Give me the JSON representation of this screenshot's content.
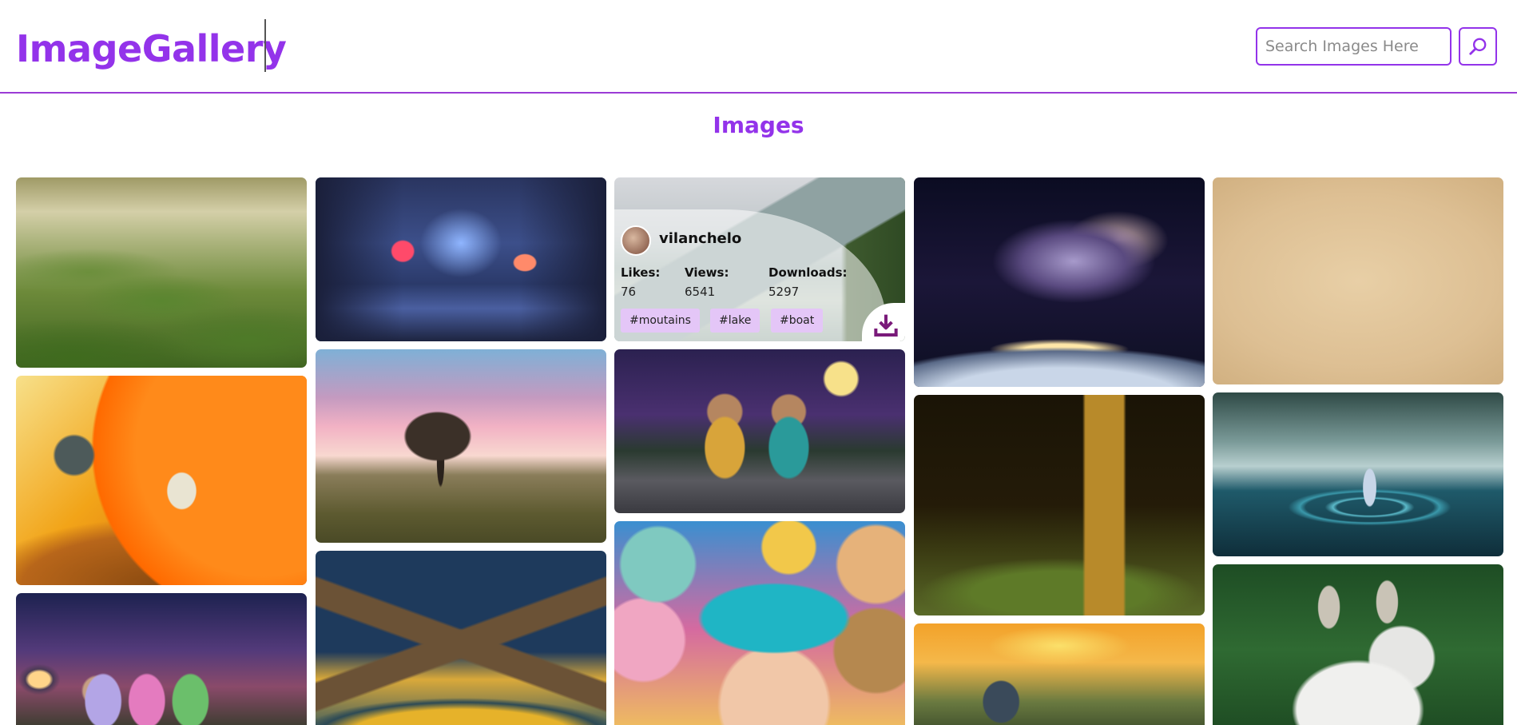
{
  "header": {
    "logo": "ImageGallery",
    "search_placeholder": "Search Images Here",
    "search_icon": "search-icon"
  },
  "section_title": "Images",
  "hover_card": {
    "username": "vilanchelo",
    "likes_label": "Likes:",
    "likes": "76",
    "views_label": "Views:",
    "views": "6541",
    "downloads_label": "Downloads:",
    "downloads": "5297",
    "tags": [
      "#moutains",
      "#lake",
      "#boat"
    ],
    "download_icon": "download-icon"
  },
  "images": [
    "misty-green-hills",
    "neon-city-street-rain",
    "mountain-lake",
    "galaxy-over-planet",
    "parchment-texture",
    "astronaut-orange-planet",
    "lone-tree-pink-sky",
    "teddy-bears-moon-path",
    "door-in-dark-field",
    "woman-in-misty-lake",
    "teddy-bears-night-house",
    "mountain-night-illustration",
    "woman-teddy-bears-flowers",
    "fishing-at-sunset",
    "white-goat"
  ],
  "colors": {
    "accent": "#9333ea",
    "tag_bg": "#e4c6f7",
    "download": "#7a1a7a"
  }
}
